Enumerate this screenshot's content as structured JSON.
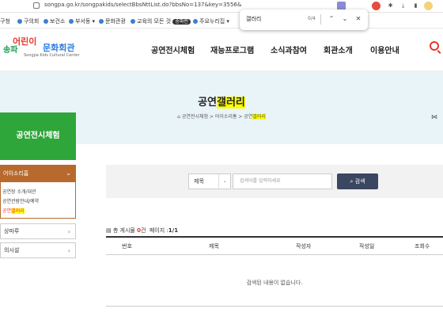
{
  "browser": {
    "url": "songpa.go.kr/songpakids/selectBbsNttList.do?bbsNo=137&key=3556&",
    "bookmarks": [
      "구청",
      "구의회",
      "보건소",
      "부서동 ▾",
      "문화관광",
      "교육의 모든 것",
      "송파런",
      "주요누리집 ▾"
    ]
  },
  "find": {
    "query": "갤러리",
    "count": "0/4"
  },
  "logo": {
    "top_left": "송파",
    "top_mid": "어린이",
    "top_right": "문화회관",
    "sub": "Songpa Kids Cultural Center"
  },
  "nav": [
    "공연전시체험",
    "재능프로그램",
    "소식과참여",
    "회관소개",
    "이용안내"
  ],
  "banner": {
    "title_pre": "공연",
    "title_hl": "갤러리",
    "breadcrumb_pre": "공연전시체험 > 어이소리홈 > 공연",
    "breadcrumb_hl": "갤러리"
  },
  "side": {
    "title": "공연전시체험",
    "active": "어이소리홈",
    "subs": [
      "공연장 소개/대관",
      "공연관람안내/예약"
    ],
    "sub_active_pre": "공연",
    "sub_active_hl": "갤러리",
    "items": [
      "상마루",
      "의시설"
    ]
  },
  "search": {
    "select_value": "제목",
    "placeholder": "검색어를 입력하세요",
    "button": "검색"
  },
  "board": {
    "total_label": "총 게시물",
    "total": "0",
    "total_unit": "건",
    "page_label": "페이지 :",
    "page": "1/1",
    "columns": [
      "번호",
      "제목",
      "작성자",
      "작성일",
      "조회수"
    ],
    "empty": "검색된 내용이 없습니다."
  }
}
